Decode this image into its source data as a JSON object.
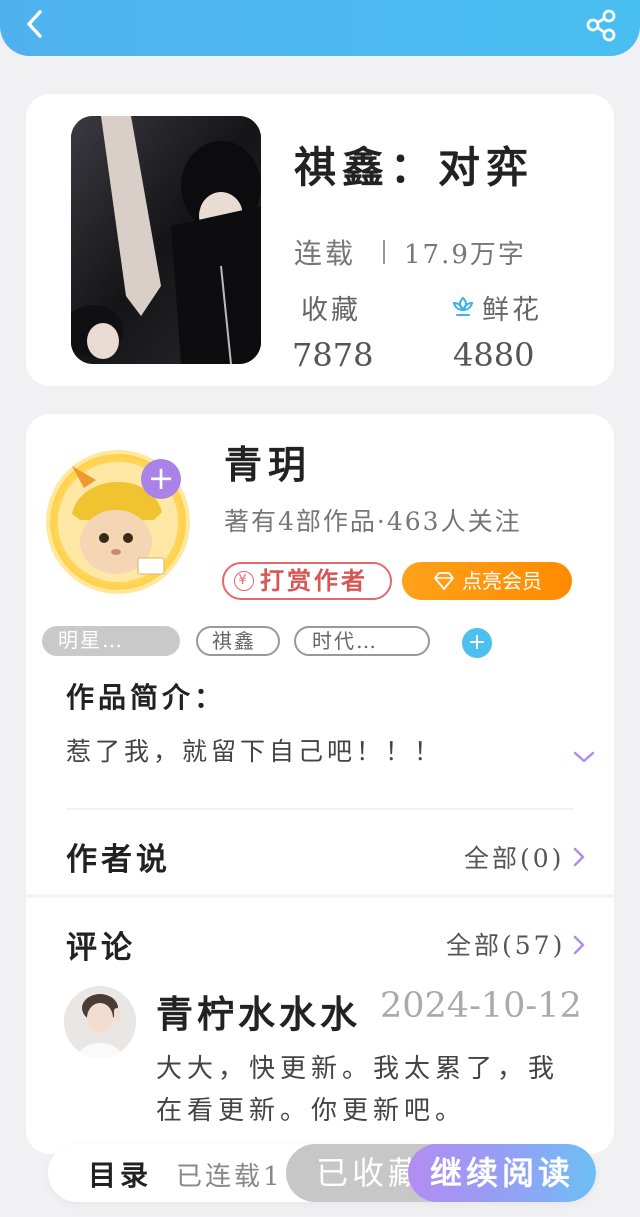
{
  "header": {
    "back_icon": "chevron-left-icon",
    "share_icon": "share-icon"
  },
  "book": {
    "title": "祺鑫：对弈",
    "status": "连载",
    "word_count": "17.9万字",
    "fav_label": "收藏",
    "fav_count": "7878",
    "flower_label": "鲜花",
    "flower_count": "4880"
  },
  "author": {
    "name": "青玥",
    "stats": "著有4部作品·463人关注",
    "tip_label": "打赏作者",
    "tip_symbol": "¥",
    "vip_label": "点亮会员",
    "follow_symbol": "+"
  },
  "tags": [
    "明星…",
    "祺鑫",
    "时代…"
  ],
  "tag_add_symbol": "+",
  "intro": {
    "title": "作品简介：",
    "text": "惹了我，就留下自己吧！！！"
  },
  "author_says": {
    "title": "作者说",
    "all_label": "全部(0)"
  },
  "comments": {
    "title": "评论",
    "all_label": "全部(57)",
    "items": [
      {
        "user": "青柠水水水",
        "date": "2024-10-12",
        "text": "大大，快更新。我太累了，我在看更新。你更新吧。"
      }
    ]
  },
  "bottom_bar": {
    "catalog": "目录",
    "serial_info": "已连载1",
    "collected": "已收藏",
    "continue": "继续阅读"
  },
  "colors": {
    "header": "#49bef1",
    "accent_purple": "#a983e8",
    "vip_orange": "#ff8a00",
    "tip_red": "#e46a6a"
  }
}
